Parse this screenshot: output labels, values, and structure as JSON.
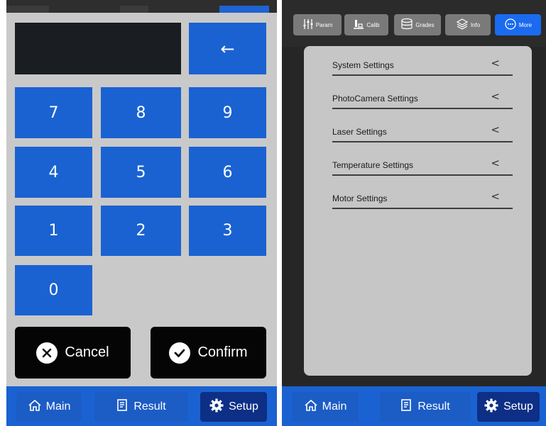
{
  "keypad": {
    "backspace": "←",
    "keys": [
      "7",
      "8",
      "9",
      "4",
      "5",
      "6",
      "1",
      "2",
      "3",
      "0"
    ],
    "cancel_label": "Cancel",
    "confirm_label": "Confirm"
  },
  "nav": {
    "main_label": "Main",
    "result_label": "Result",
    "setup_label": "Setup",
    "active": "Setup"
  },
  "tabs": [
    {
      "label": "Param",
      "icon": "sliders-icon"
    },
    {
      "label": "Calib",
      "icon": "calib-icon"
    },
    {
      "label": "Grades",
      "icon": "database-icon"
    },
    {
      "label": "Info",
      "icon": "layers-icon"
    },
    {
      "label": "More",
      "icon": "more-icon",
      "active": true
    }
  ],
  "settings": {
    "items": [
      {
        "label": "System Settings"
      },
      {
        "label": "PhotoCamera Settings"
      },
      {
        "label": "Laser Settings"
      },
      {
        "label": "Temperature Settings"
      },
      {
        "label": "Motor Settings"
      }
    ],
    "chevron": "<"
  },
  "colors": {
    "accent_blue": "#1a62d1",
    "active_nav": "#0d2f86",
    "active_tab": "#1a6bf0",
    "panel_gray": "#c9c9c9",
    "dark_bg": "#262626"
  }
}
